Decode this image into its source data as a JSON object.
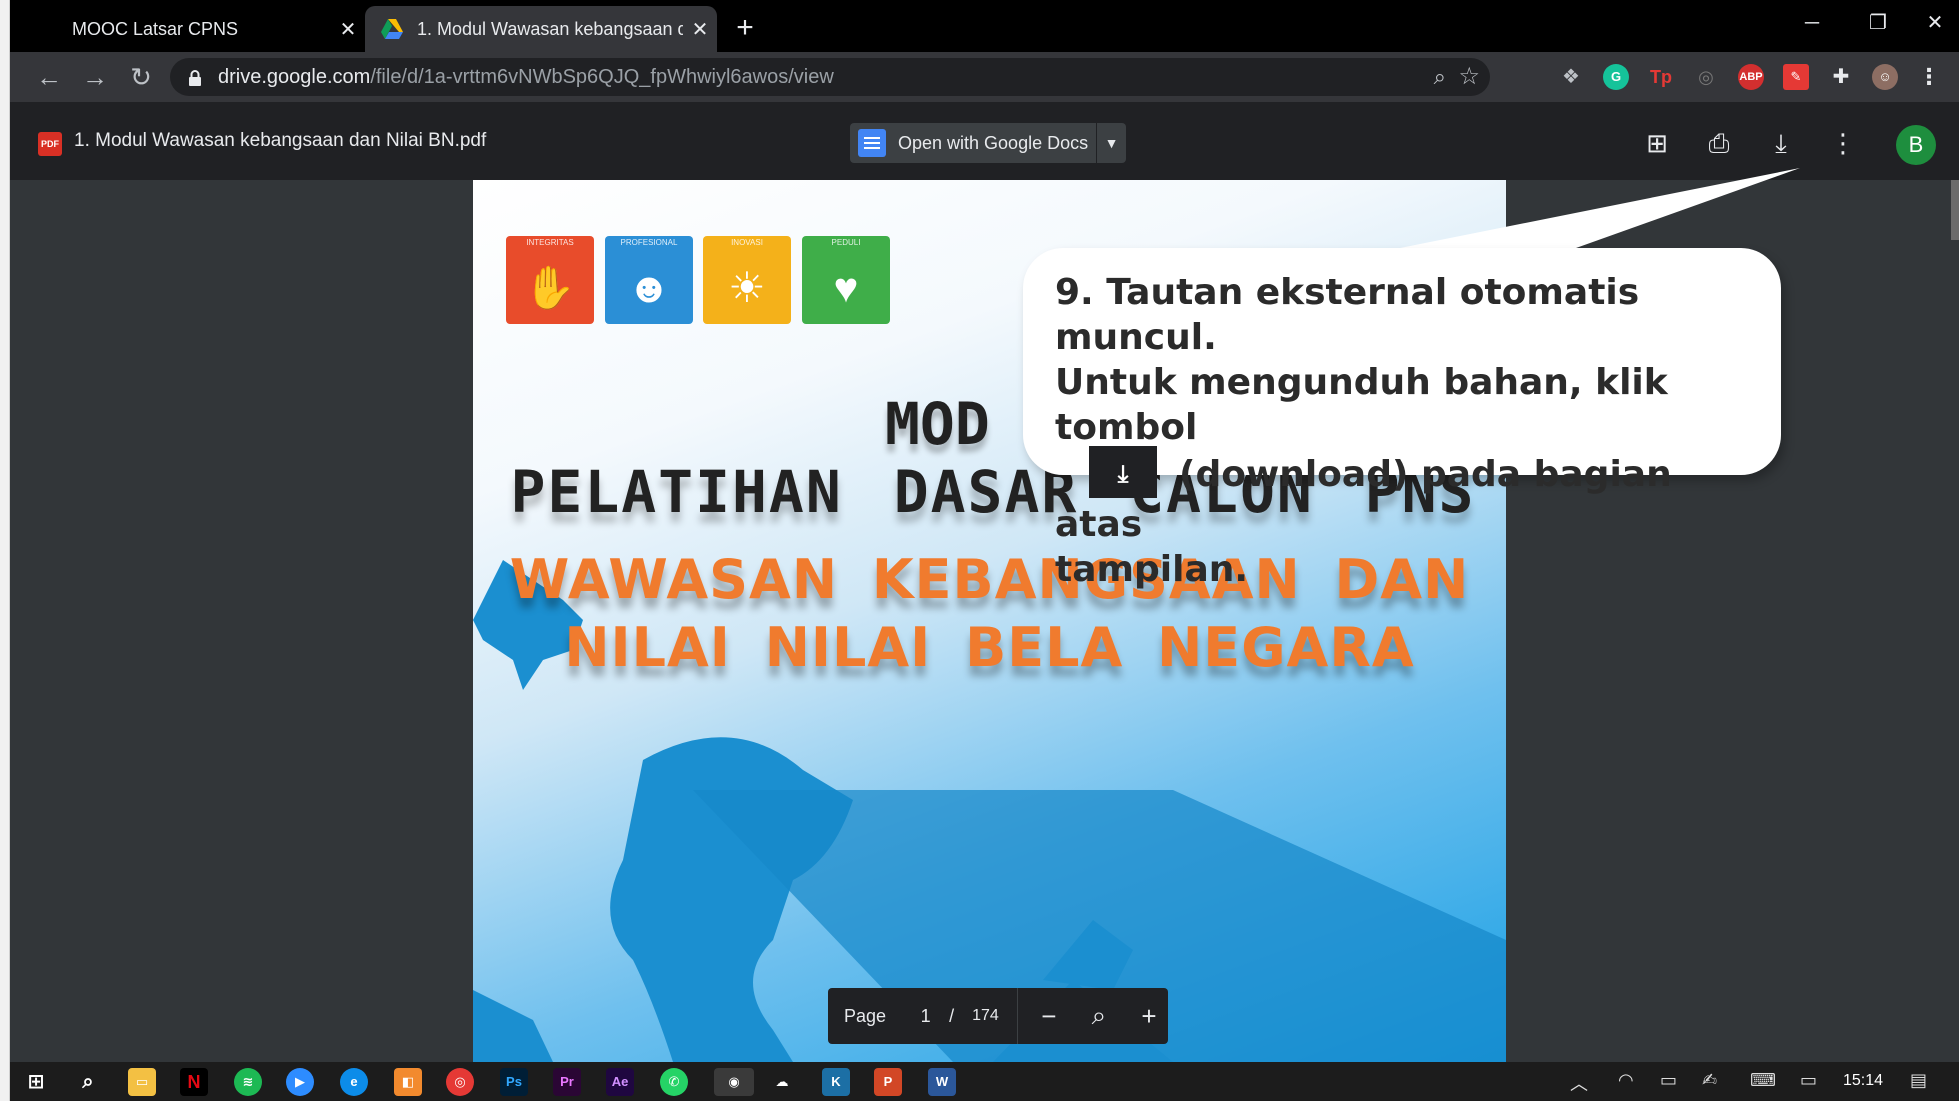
{
  "browser": {
    "tabs": [
      {
        "title": "MOOC Latsar CPNS",
        "active": false
      },
      {
        "title": "1. Modul Wawasan kebangsaan d",
        "active": true
      }
    ],
    "url_host": "drive.google.com",
    "url_path": "/file/d/1a-vrttm6vNWbSp6QJQ_fpWhwiyl6awos/view",
    "extensions": [
      "dropbox-icon",
      "grammarly-icon",
      "tp-icon",
      "extension-gray-icon",
      "adblock-plus-icon",
      "pdf-extension-icon",
      "puzzle-icon",
      "profile-icon"
    ]
  },
  "viewer": {
    "file_name": "1. Modul Wawasan kebangsaan dan Nilai BN.pdf",
    "open_with_label": "Open with Google Docs",
    "avatar_letter": "B"
  },
  "document": {
    "value_tiles": [
      {
        "label": "INTEGRITAS",
        "color": "#e84c2b",
        "glyph": "🤝"
      },
      {
        "label": "PROFESIONAL",
        "color": "#2b8fd6",
        "glyph": "☻"
      },
      {
        "label": "INOVASI",
        "color": "#f4b11a",
        "glyph": "💡"
      },
      {
        "label": "PEDULI",
        "color": "#3fae49",
        "glyph": "♥"
      }
    ],
    "title_line_1": "MOD",
    "title_line_2": "PELATIHAN DASAR CALON PNS",
    "subtitle_line_1": "WAWASAN KEBANGSAAN DAN",
    "subtitle_line_2": "NILAI NILAI BELA NEGARA"
  },
  "page_controls": {
    "label": "Page",
    "current": "1",
    "separator": "/",
    "total": "174"
  },
  "callout": {
    "line_1": "9. Tautan eksternal otomatis muncul.",
    "line_2": "Untuk mengunduh bahan, klik tombol",
    "line_3": "(download) pada bagian atas",
    "line_4": "tampilan."
  },
  "taskbar": {
    "clock": "15:14"
  }
}
